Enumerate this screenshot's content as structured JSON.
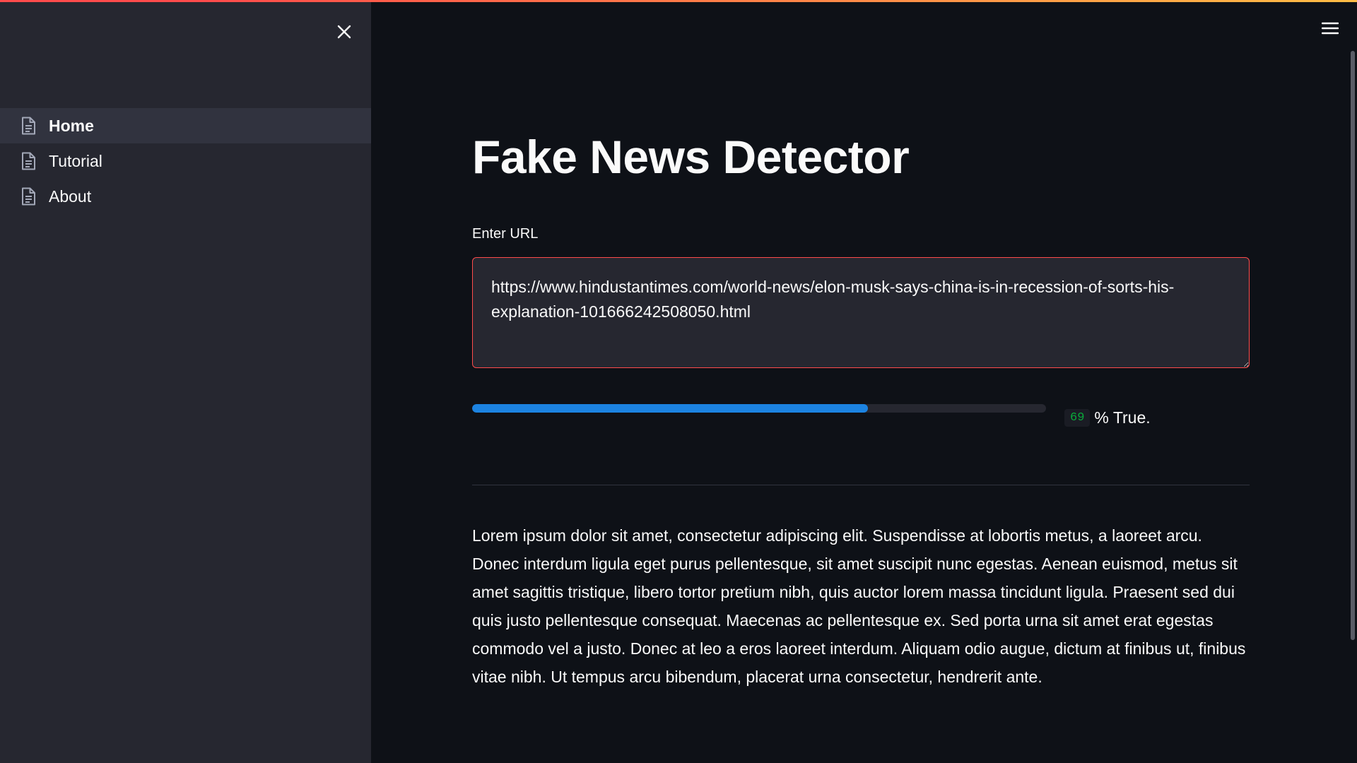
{
  "sidebar": {
    "items": [
      {
        "label": "Home",
        "icon": "document-icon",
        "active": true
      },
      {
        "label": "Tutorial",
        "icon": "document-icon",
        "active": false
      },
      {
        "label": "About",
        "icon": "document-icon",
        "active": false
      }
    ]
  },
  "main": {
    "title": "Fake News Detector",
    "input_label": "Enter URL",
    "url_value": "https://www.hindustantimes.com/world-news/elon-musk-says-china-is-in-recession-of-sorts-his-explanation-101666242508050.html",
    "progress_percent": 69,
    "result_value": "69",
    "result_suffix": "% True.",
    "body_text": "Lorem ipsum dolor sit amet, consectetur adipiscing elit. Suspendisse at lobortis metus, a laoreet arcu. Donec interdum ligula eget purus pellentesque, sit amet suscipit nunc egestas. Aenean euismod, metus sit amet sagittis tristique, libero tortor pretium nibh, quis auctor lorem massa tincidunt ligula. Praesent sed dui quis justo pellentesque consequat. Maecenas ac pellentesque ex. Sed porta urna sit amet erat egestas commodo vel a justo. Donec at leo a eros laoreet interdum. Aliquam odio augue, dictum at finibus ut, finibus vitae nibh. Ut tempus arcu bibendum, placerat urna consectetur, hendrerit ante."
  },
  "colors": {
    "accent": "#ff4b4b",
    "progress": "#1c83e1",
    "badge_text": "#09ab3b",
    "background": "#0e1117",
    "sidebar": "#262730"
  }
}
